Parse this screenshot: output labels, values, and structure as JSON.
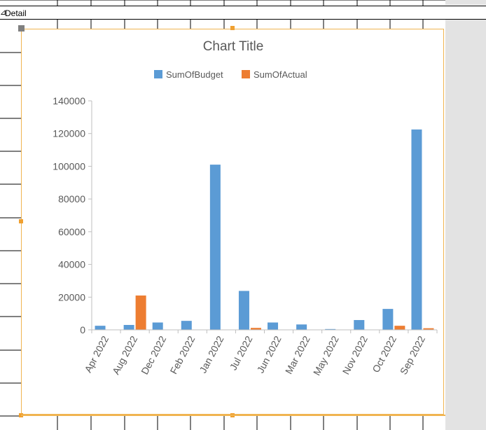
{
  "section": {
    "label": "Detail",
    "icon": "section-selector-icon"
  },
  "chart_data": {
    "type": "bar",
    "title": "Chart Title",
    "categories": [
      "Apr 2022",
      "Aug 2022",
      "Dec 2022",
      "Feb 2022",
      "Jan 2022",
      "Jul 2022",
      "Jun 2022",
      "Mar 2022",
      "May 2022",
      "Nov 2022",
      "Oct 2022",
      "Sep 2022"
    ],
    "series": [
      {
        "name": "SumOfBudget",
        "color": "#5b9bd5",
        "values": [
          2500,
          3000,
          4500,
          5500,
          101000,
          23800,
          4500,
          3300,
          500,
          6000,
          12800,
          122500
        ]
      },
      {
        "name": "SumOfActual",
        "color": "#ed7d31",
        "values": [
          0,
          21000,
          0,
          0,
          0,
          1200,
          0,
          0,
          0,
          0,
          2500,
          1000
        ]
      }
    ],
    "yticks": [
      "0",
      "20000",
      "40000",
      "60000",
      "80000",
      "100000",
      "120000",
      "140000"
    ],
    "ylim": [
      0,
      140000
    ],
    "legend": "top",
    "grid": false
  }
}
